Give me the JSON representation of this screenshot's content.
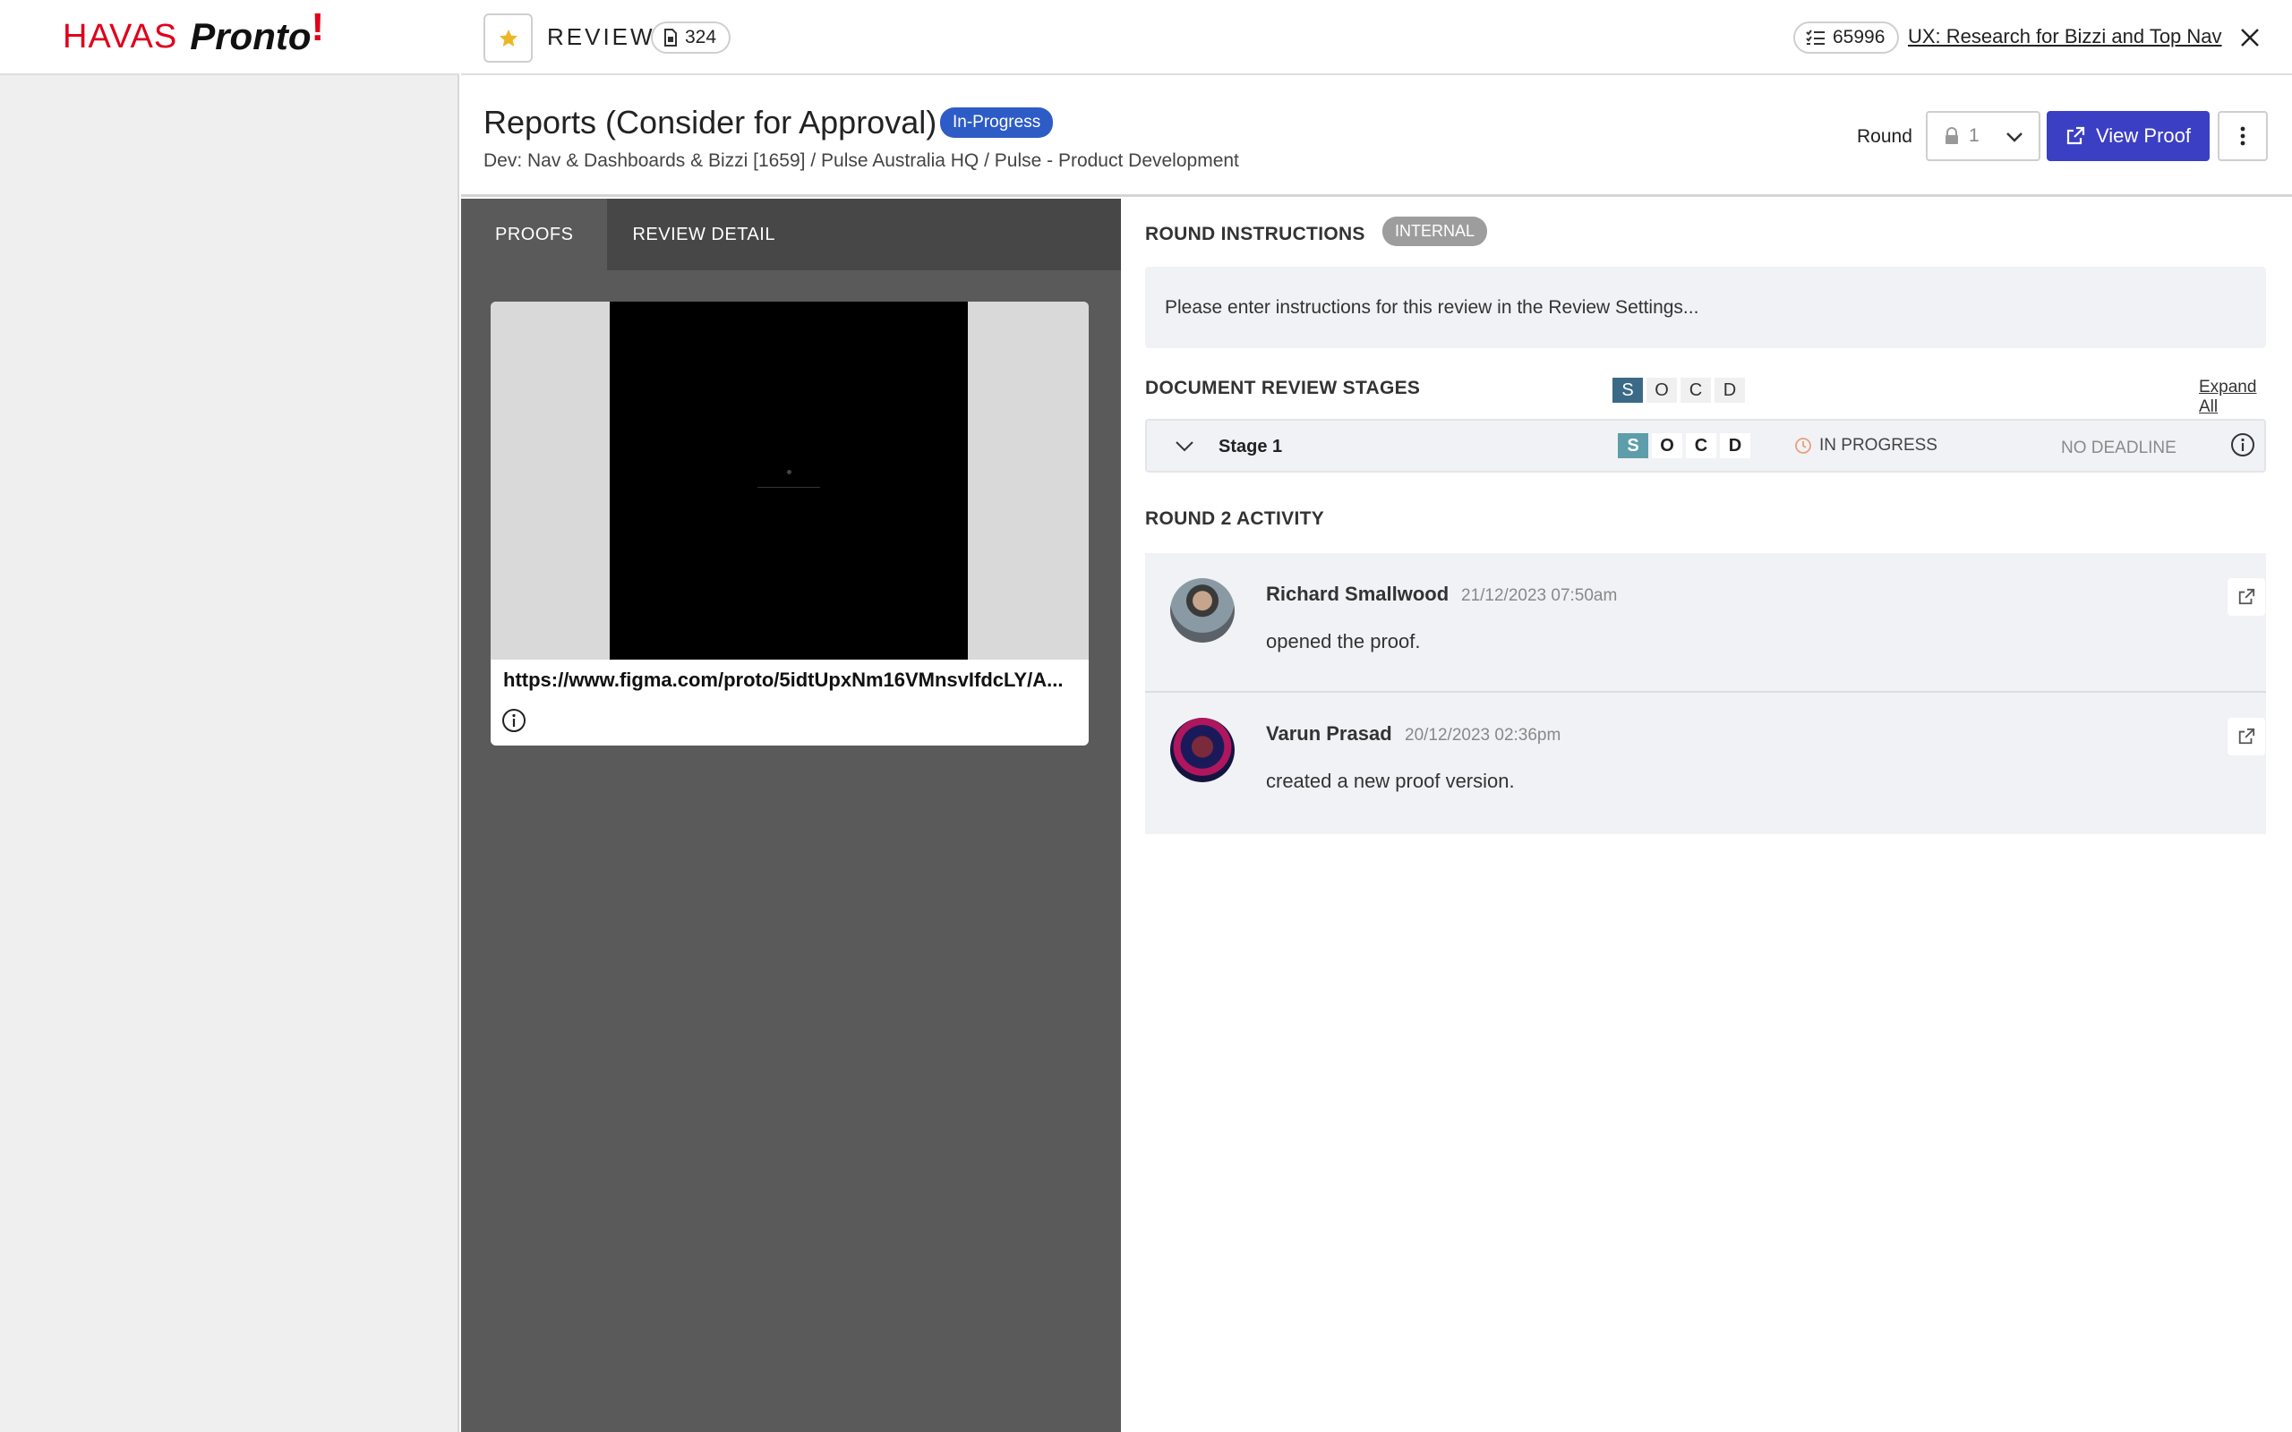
{
  "brand": {
    "havas": "HAVAS",
    "pronto": "Pronto",
    "bolt": "!"
  },
  "topbar": {
    "section_label": "REVIEW",
    "doc_count": "324",
    "task_count": "65996",
    "project_link": "UX: Research for Bizzi and Top Nav"
  },
  "header": {
    "title": "Reports (Consider for Approval)",
    "status": "In-Progress",
    "breadcrumb": "Dev: Nav & Dashboards & Bizzi [1659] / Pulse Australia HQ / Pulse - Product Development",
    "round_label": "Round",
    "round_value": "1",
    "view_proof_label": "View Proof"
  },
  "proofs": {
    "tabs": [
      "PROOFS",
      "REVIEW DETAIL"
    ],
    "card": {
      "url": "https://www.figma.com/proto/5idtUpxNm16VMnsvIfdcLY/A..."
    }
  },
  "instructions": {
    "title": "ROUND INSTRUCTIONS",
    "badge": "INTERNAL",
    "text": "Please enter instructions for this review in the Review Settings..."
  },
  "stages": {
    "title": "DOCUMENT REVIEW STAGES",
    "socd": [
      "S",
      "O",
      "C",
      "D"
    ],
    "expand_all": "Expand All",
    "rows": [
      {
        "name": "Stage 1",
        "status": "IN PROGRESS",
        "deadline": "NO DEADLINE"
      }
    ]
  },
  "activity": {
    "title": "ROUND 2 ACTIVITY",
    "items": [
      {
        "name": "Richard Smallwood",
        "time": "21/12/2023 07:50am",
        "text": "opened the proof."
      },
      {
        "name": "Varun Prasad",
        "time": "20/12/2023 02:36pm",
        "text": "created a new proof version."
      }
    ]
  },
  "colors": {
    "brand_red": "#e0001b",
    "primary": "#3b3fc4",
    "status_blue": "#2d5cc6",
    "stage_active": "#3a6a86"
  }
}
